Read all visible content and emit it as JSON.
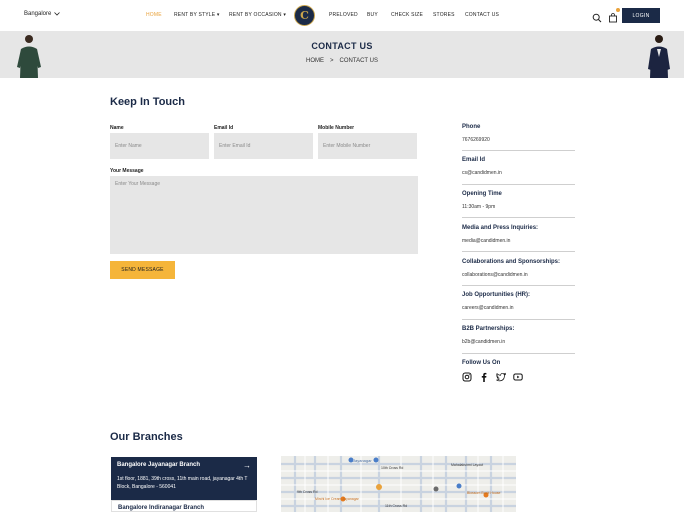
{
  "header": {
    "location": "Bangalore",
    "nav": [
      "HOME",
      "RENT BY STYLE",
      "RENT BY OCCASION",
      "PRELOVED",
      "BUY",
      "CHECK SIZE",
      "STORES",
      "CONTACT US"
    ],
    "logo_letter": "C",
    "login": "LOGIN",
    "accent": "#e9a23b",
    "brand": "#1b2a47"
  },
  "banner": {
    "title": "CONTACT US",
    "crumb_home": "HOME",
    "crumb_sep": ">",
    "crumb_current": "CONTACT US"
  },
  "form": {
    "heading": "Keep In Touch",
    "name_label": "Name",
    "name_placeholder": "Enter Name",
    "email_label": "Email Id",
    "email_placeholder": "Enter Email Id",
    "mobile_label": "Mobile Number",
    "mobile_placeholder": "Enter Mobile Number",
    "message_label": "Your Message",
    "message_placeholder": "Enter Your Message",
    "submit": "SEND MESSAGE"
  },
  "info": [
    {
      "label": "Phone",
      "value": "7676269920"
    },
    {
      "label": "Email Id",
      "value": "cs@candidmen.in"
    },
    {
      "label": "Opening Time",
      "value": "11:30am - 9pm"
    },
    {
      "label": "Media and Press Inquiries:",
      "value": "media@candidmen.in"
    },
    {
      "label": "Collaborations and Sponsorships:",
      "value": "collaborations@candidmen.in"
    },
    {
      "label": "Job Opportunities (HR):",
      "value": "careers@candidmen.in"
    },
    {
      "label": "B2B Partnerships:",
      "value": "b2b@candidmen.in"
    }
  ],
  "follow_label": "Follow Us On",
  "socials": [
    "instagram-icon",
    "facebook-icon",
    "twitter-icon",
    "youtube-icon"
  ],
  "branches": {
    "heading": "Our Branches",
    "items": [
      {
        "name": "Bangalore Jayanagar Branch",
        "address": "1st floor, 1881, 39th cross, 11th main road, jayanagar 4th T Block, Bangalore - 560041"
      },
      {
        "name": "Bangalore Indiranagar Branch",
        "address": ""
      }
    ],
    "map_labels": [
      "Jayanagar",
      "10th Cross Rd",
      "9th Cross Rd",
      "Mahalakshmi Layout",
      "Mirchi Ice Cream Jayanagar",
      "11th Cross Rd",
      "Blossom Book House"
    ]
  }
}
